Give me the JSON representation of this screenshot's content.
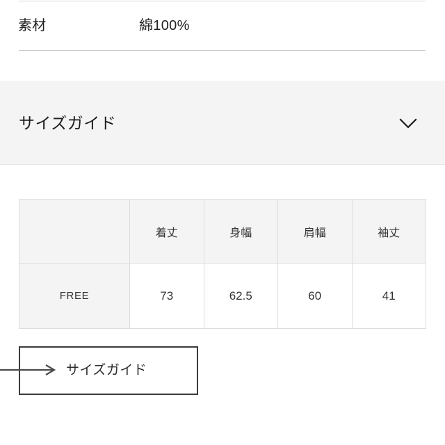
{
  "spec": {
    "label": "素材",
    "value": "綿100%"
  },
  "accordion": {
    "title": "サイズガイド",
    "chevron_icon": "chevron-down-icon",
    "expanded": true
  },
  "size_table": {
    "corner_header": "",
    "column_headers": [
      "着丈",
      "身幅",
      "肩幅",
      "袖丈"
    ],
    "rows": [
      {
        "size": "FREE",
        "values": [
          "73",
          "62.5",
          "60",
          "41"
        ]
      }
    ]
  },
  "callout": {
    "label": "サイズガイド",
    "arrow_icon": "arrow-right-icon"
  },
  "colors": {
    "page_background": "#ffffff",
    "band_background": "#f4f4f4",
    "table_header_background": "#f4f4f4",
    "table_border": "#dddddd",
    "divider": "#c9c9c9",
    "text": "#242424",
    "callout_border": "#3b3b3b"
  }
}
